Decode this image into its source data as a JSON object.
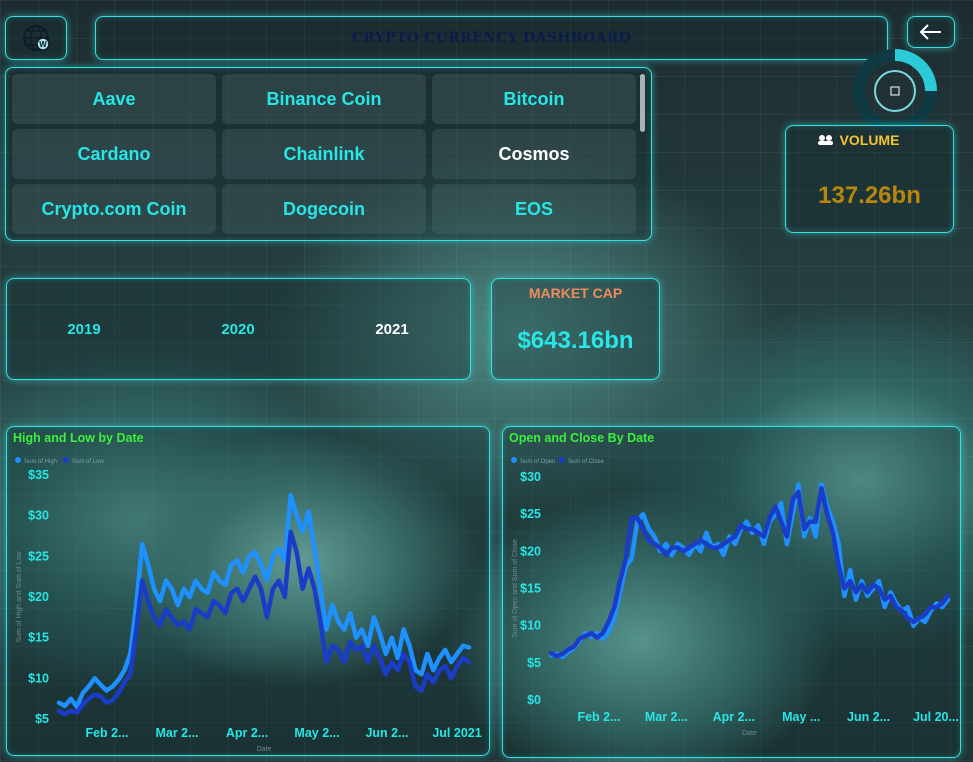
{
  "header": {
    "title": "CRYPTO CURRENCY DASHBOARD",
    "logo_icon": "globe-icon",
    "back_icon": "back-arrow-icon"
  },
  "coins": {
    "items": [
      {
        "label": "Aave",
        "selected": false
      },
      {
        "label": "Binance Coin",
        "selected": false
      },
      {
        "label": "Bitcoin",
        "selected": false
      },
      {
        "label": "Cardano",
        "selected": false
      },
      {
        "label": "Chainlink",
        "selected": false
      },
      {
        "label": "Cosmos",
        "selected": true
      },
      {
        "label": "Crypto.com Coin",
        "selected": false
      },
      {
        "label": "Dogecoin",
        "selected": false
      },
      {
        "label": "EOS",
        "selected": false
      }
    ]
  },
  "volume": {
    "label": "VOLUME",
    "value": "137.26bn",
    "icon": "volume-icon",
    "label_color": "#f4c430",
    "value_color": "#b8860b"
  },
  "years": {
    "items": [
      {
        "label": "2019",
        "selected": false
      },
      {
        "label": "2020",
        "selected": false
      },
      {
        "label": "2021",
        "selected": true
      }
    ]
  },
  "market_cap": {
    "label": "MARKET CAP",
    "value": "$643.16bn",
    "label_color": "#f08a5d",
    "value_color": "#27e6e6"
  },
  "chart_data": [
    {
      "type": "line",
      "title": "High and Low by Date",
      "xlabel": "Date",
      "ylabel": "Sum of High and Sum of Low",
      "legend": [
        "Sum of High",
        "Sum of Low"
      ],
      "legend_position": "top-left",
      "x_ticks": [
        "Feb 2...",
        "Mar 2...",
        "Apr 2...",
        "May 2...",
        "Jun 2...",
        "Jul 2021"
      ],
      "y_ticks": [
        "$5",
        "$10",
        "$15",
        "$20",
        "$25",
        "$30",
        "$35"
      ],
      "ylim": [
        5,
        35
      ],
      "colors": [
        "#1e90ff",
        "#1a3dc8"
      ],
      "x_days": [
        0,
        3,
        6,
        9,
        12,
        15,
        18,
        21,
        24,
        27,
        30,
        33,
        36,
        39,
        42,
        45,
        48,
        51,
        54,
        57,
        60,
        63,
        66,
        69,
        72,
        75,
        78,
        81,
        84,
        87,
        90,
        93,
        96,
        99,
        102,
        105,
        108,
        111,
        114,
        117,
        120,
        123,
        126,
        129,
        132,
        135,
        138,
        141,
        144,
        147,
        150,
        153,
        156,
        159,
        162,
        165,
        168,
        171,
        174,
        177,
        180,
        183,
        186,
        189,
        192,
        195,
        198,
        201,
        204,
        207
      ],
      "series": [
        {
          "name": "Sum of High",
          "values": [
            7,
            6.6,
            7.5,
            6.5,
            8.2,
            9,
            10,
            9.2,
            8.5,
            9,
            9.8,
            11,
            13,
            19,
            26.5,
            24,
            21,
            19.5,
            22,
            21,
            19,
            21,
            20,
            22,
            21,
            20.5,
            23,
            22,
            21.5,
            24,
            24.5,
            23,
            25,
            25.5,
            24,
            22,
            25,
            26,
            24.5,
            32.5,
            30,
            28,
            30.5,
            26,
            21,
            16,
            19,
            17,
            16,
            18,
            15,
            16,
            14,
            17.5,
            15.5,
            13,
            15,
            12.5,
            16,
            14,
            11,
            10.5,
            13,
            11,
            12.5,
            13.5,
            12,
            13,
            14,
            13.8
          ]
        },
        {
          "name": "Sum of Low",
          "values": [
            6,
            5.6,
            6,
            5.8,
            6.8,
            7.5,
            8,
            7.8,
            7,
            7.3,
            8.2,
            9.5,
            10.5,
            16,
            22,
            19.5,
            17.5,
            16.5,
            18.5,
            17.5,
            16.5,
            17,
            16,
            18.5,
            18,
            17.5,
            19.5,
            19,
            18,
            20.5,
            21,
            19.5,
            21,
            22.5,
            21,
            17.5,
            21,
            22,
            20,
            28,
            25.5,
            21,
            23.5,
            21,
            17,
            12,
            14,
            13.5,
            12,
            14.5,
            13.5,
            14,
            12,
            14,
            12.5,
            10.5,
            12,
            11,
            13,
            12,
            9,
            8.5,
            10.5,
            9.5,
            11,
            11.5,
            10,
            11.5,
            12.5,
            12
          ]
        }
      ]
    },
    {
      "type": "line",
      "title": "Open and Close By Date",
      "xlabel": "Date",
      "ylabel": "Sum of Open and Sum of Close",
      "legend": [
        "Sum of Open",
        "Sum of Close"
      ],
      "legend_position": "top-left",
      "x_ticks": [
        "Feb 2...",
        "Mar 2...",
        "Apr 2...",
        "May ...",
        "Jun 2...",
        "Jul 20..."
      ],
      "y_ticks": [
        "$0",
        "$5",
        "$10",
        "$15",
        "$20",
        "$25",
        "$30"
      ],
      "ylim": [
        0,
        30
      ],
      "colors": [
        "#1e90ff",
        "#1a3dc8"
      ],
      "x_days": [
        0,
        3,
        6,
        9,
        12,
        15,
        18,
        21,
        24,
        27,
        30,
        33,
        36,
        39,
        42,
        45,
        48,
        51,
        54,
        57,
        60,
        63,
        66,
        69,
        72,
        75,
        78,
        81,
        84,
        87,
        90,
        93,
        96,
        99,
        102,
        105,
        108,
        111,
        114,
        117,
        120,
        123,
        126,
        129,
        132,
        135,
        138,
        141,
        144,
        147,
        150,
        153,
        156,
        159,
        162,
        165,
        168,
        171,
        174,
        177,
        180,
        183,
        186,
        189,
        192,
        195,
        198,
        201,
        204,
        207
      ],
      "series": [
        {
          "name": "Sum of Open",
          "values": [
            6,
            6.2,
            5.8,
            6.5,
            7,
            8,
            9,
            8.5,
            9,
            8.2,
            9.2,
            11,
            14.5,
            18,
            19,
            24,
            25,
            23,
            22,
            20,
            21,
            19.5,
            21,
            20.5,
            19.5,
            21,
            20,
            22.5,
            20.5,
            21,
            19.5,
            22,
            21,
            23,
            24,
            22.5,
            23.5,
            21,
            24,
            25,
            26.5,
            21,
            25,
            29,
            22,
            24.5,
            22,
            29,
            26,
            24,
            21,
            14,
            17.5,
            13.5,
            16,
            14,
            15,
            16,
            12.5,
            14.5,
            13,
            12,
            12.5,
            10,
            11,
            10.5,
            12,
            13,
            12.5,
            13.5
          ]
        },
        {
          "name": "Sum of Close",
          "values": [
            6.3,
            5.9,
            6.2,
            6.8,
            7.2,
            8.3,
            8.6,
            9,
            8.4,
            9,
            10.5,
            12.5,
            16,
            19,
            24.5,
            24.5,
            23,
            21.5,
            21,
            20.5,
            19.5,
            20.5,
            20.5,
            20,
            20.5,
            21,
            21.5,
            21,
            20.5,
            20.5,
            21,
            21.5,
            22,
            23.5,
            23,
            23,
            22.5,
            22,
            24.5,
            26,
            24,
            22,
            27,
            28,
            23,
            24,
            24,
            28.5,
            25,
            22.5,
            18,
            15,
            16,
            14.5,
            15.5,
            14.5,
            15.5,
            15,
            13.5,
            14,
            12.5,
            12,
            11,
            10.5,
            11,
            11.5,
            12.5,
            12.5,
            13,
            14
          ]
        }
      ]
    }
  ]
}
